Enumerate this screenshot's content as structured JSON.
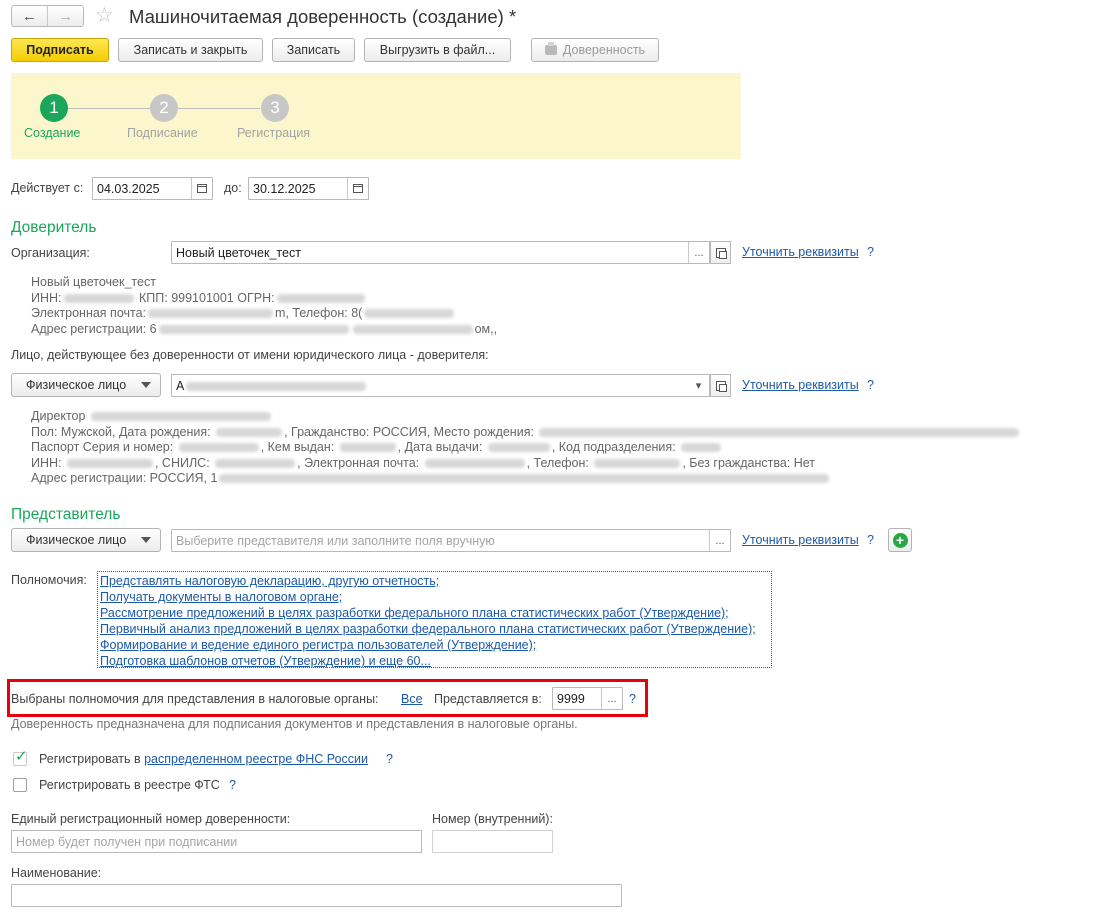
{
  "header": {
    "title": "Машиночитаемая доверенность (создание) *",
    "nav_back": "←",
    "nav_forward": "→",
    "favorite_icon": "☆"
  },
  "toolbar": {
    "sign": "Подписать",
    "save_close": "Записать и закрыть",
    "save": "Записать",
    "export": "Выгрузить в файл...",
    "poa_print": "Доверенность"
  },
  "steps": [
    {
      "number": "1",
      "label": "Создание"
    },
    {
      "number": "2",
      "label": "Подписание"
    },
    {
      "number": "3",
      "label": "Регистрация"
    }
  ],
  "validity": {
    "from_label": "Действует с:",
    "from_value": "04.03.2025",
    "to_label": "до:",
    "to_value": "30.12.2025"
  },
  "principal": {
    "section_title": "Доверитель",
    "org_label": "Организация:",
    "org_value": "Новый цветочек_тест",
    "clarify": "Уточнить реквизиты",
    "help": "?",
    "details": {
      "name": "Новый цветочек_тест",
      "inn_label": "ИНН:",
      "kpp_ogrn": "КПП: 999101001 ОГРН:",
      "email_label": "Электронная почта:",
      "email_tail": "m, Телефон: 8(",
      "address_label": "Адрес регистрации: 6",
      "address_tail": "ом,,"
    },
    "person_label": "Лицо, действующее без доверенности от имени юридического лица - доверителя:",
    "person_type": "Физическое лицо",
    "person_value": "А",
    "person_details": {
      "position": "Директор",
      "line2": "Пол: Мужской, Дата рождения: ",
      "line2_b": ", Гражданство: РОССИЯ, Место рождения:",
      "line3": "Паспорт Серия и номер: ",
      "line3_b": ", Кем выдан: ",
      "line3_c": ", Дата выдачи: ",
      "line3_d": ", Код подразделения: ",
      "line4": "ИНН: ",
      "line4_b": ", СНИЛС: ",
      "line4_c": ", Электронная почта: ",
      "line4_d": ", Телефон: ",
      "line4_e": ", Без гражданства: Нет",
      "line5": "Адрес регистрации: РОССИЯ, 1"
    }
  },
  "representative": {
    "section_title": "Представитель",
    "type": "Физическое лицо",
    "placeholder": "Выберите представителя или заполните поля вручную",
    "clarify": "Уточнить реквизиты",
    "help": "?"
  },
  "powers": {
    "label": "Полномочия:",
    "items": [
      "Представлять налоговую декларацию, другую отчетность;",
      "Получать документы в налоговом органе;",
      "Рассмотрение предложений в целях разработки федерального плана статистических работ (Утверждение);",
      "Первичный анализ предложений в целях разработки федерального плана статистических работ (Утверждение);",
      "Формирование и ведение единого регистра пользователей (Утверждение);",
      "Подготовка шаблонов отчетов (Утверждение) и еще 60..."
    ]
  },
  "tax": {
    "selected_label": "Выбраны полномочия для представления в налоговые органы:",
    "all_link": "Все",
    "presented_label": "Представляется в:",
    "presented_value": "9999",
    "help": "?",
    "note": "Доверенность предназначена для подписания документов и представления в налоговые органы."
  },
  "registration": {
    "fns_prefix": "Регистрировать в",
    "fns_link": "распределенном реестре ФНС России",
    "fns_checked": true,
    "fts_label": "Регистрировать в реестре ФТС",
    "fts_checked": false,
    "help": "?"
  },
  "numbers": {
    "unified_label": "Единый регистрационный номер доверенности:",
    "unified_placeholder": "Номер будет получен при подписании",
    "internal_label": "Номер (внутренний):",
    "internal_value": "",
    "name_label": "Наименование:",
    "name_value": ""
  },
  "colors": {
    "accent_green": "#1aa65b",
    "link_blue": "#1d5aa6",
    "primary_yellow": "#f3cd00",
    "highlight_red": "#e8000a",
    "stepper_bg": "#fbf6cb"
  }
}
